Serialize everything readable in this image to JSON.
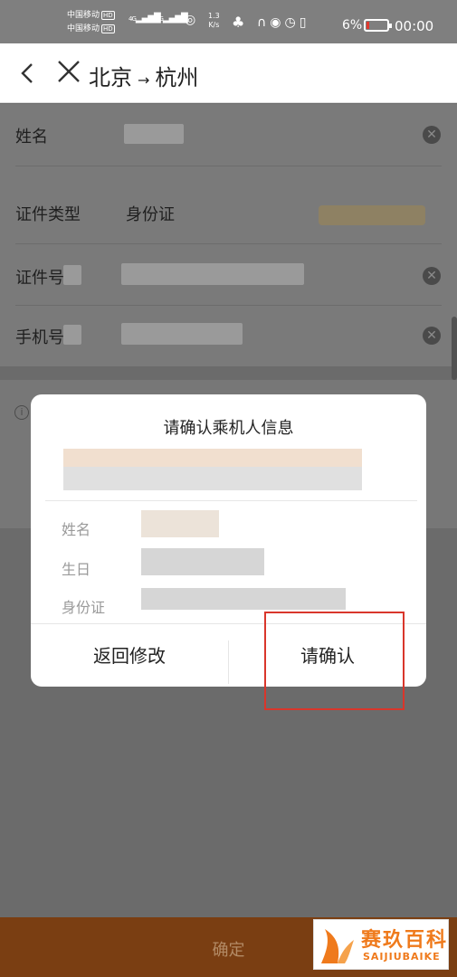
{
  "status_bar": {
    "carrier_1": "中国移动",
    "carrier_2": "中国移动",
    "hd": "HD",
    "network": "4G",
    "speed_value": "1.3",
    "speed_unit": "K/s",
    "battery_percent": "6%",
    "battery_level": 0.06,
    "time": "00:00"
  },
  "nav": {
    "from": "北京",
    "arrow": "→",
    "to": "杭州"
  },
  "form": {
    "name_label": "姓名",
    "id_type_label": "证件类型",
    "id_type_value": "身份证",
    "id_number_label": "证件号",
    "phone_label": "手机号"
  },
  "dialog": {
    "title": "请确认乘机人信息",
    "fields": [
      "姓名",
      "生日",
      "身份证"
    ],
    "back_button": "返回修改",
    "confirm_button": "请确认"
  },
  "bottom": {
    "confirm": "确定"
  },
  "watermark": {
    "name": "赛玖百科",
    "name_en": "SAIJIUBAIKE",
    "color": "#ef7a1c"
  }
}
